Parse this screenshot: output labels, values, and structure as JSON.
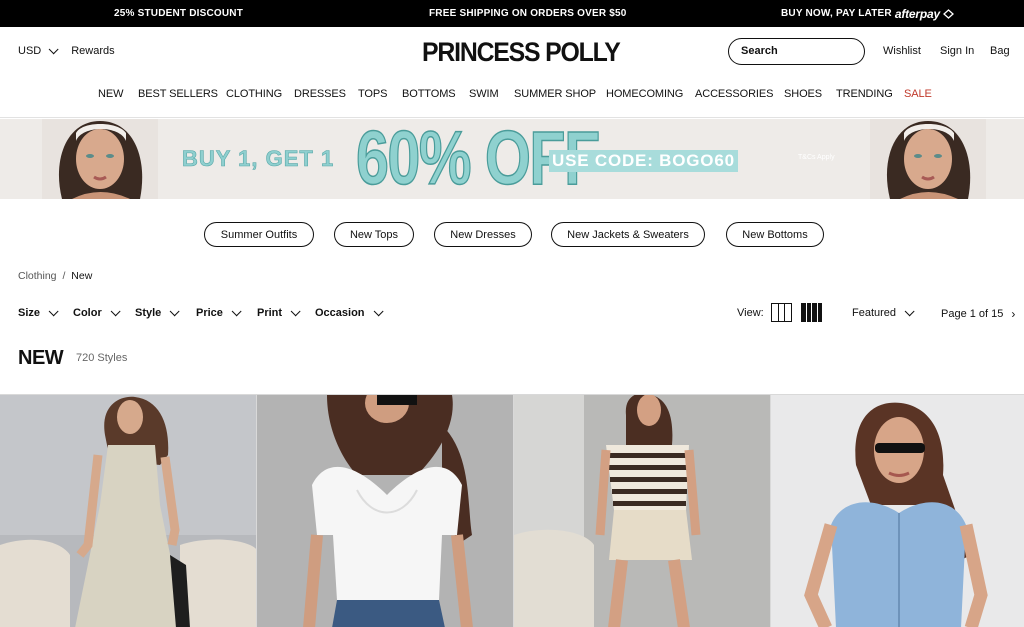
{
  "announcement": {
    "left": "25% STUDENT DISCOUNT",
    "center": "FREE SHIPPING ON ORDERS OVER $50",
    "right": "BUY NOW, PAY LATER",
    "right_brand": "afterpay"
  },
  "header": {
    "currency": "USD",
    "rewards": "Rewards",
    "logo": "PRINCESS POLLY",
    "search_placeholder": "Search",
    "wishlist": "Wishlist",
    "sign_in": "Sign In",
    "bag": "Bag"
  },
  "nav": [
    "NEW",
    "BEST SELLERS",
    "CLOTHING",
    "DRESSES",
    "TOPS",
    "BOTTOMS",
    "SWIM",
    "SUMMER SHOP",
    "HOMECOMING",
    "ACCESSORIES",
    "SHOES",
    "TRENDING",
    "SALE"
  ],
  "banner": {
    "offer": "BUY 1, GET 1",
    "discount": "60% OFF",
    "code": "USE CODE: BOGO60",
    "terms": "T&Cs Apply"
  },
  "quick_links": [
    "Summer Outfits",
    "New Tops",
    "New Dresses",
    "New Jackets & Sweaters",
    "New Bottoms"
  ],
  "breadcrumb": {
    "parent": "Clothing",
    "separator": "/",
    "current": "New"
  },
  "filters": [
    "Size",
    "Color",
    "Style",
    "Price",
    "Print",
    "Occasion"
  ],
  "view_label": "View:",
  "sort": "Featured",
  "pagination": "Page 1 of 15",
  "listing": {
    "title": "NEW",
    "count": "720 Styles"
  },
  "colors": {
    "accent_sale": "#c0392b",
    "banner_teal": "#8fd1cf",
    "banner_bg": "#eeebe8"
  }
}
